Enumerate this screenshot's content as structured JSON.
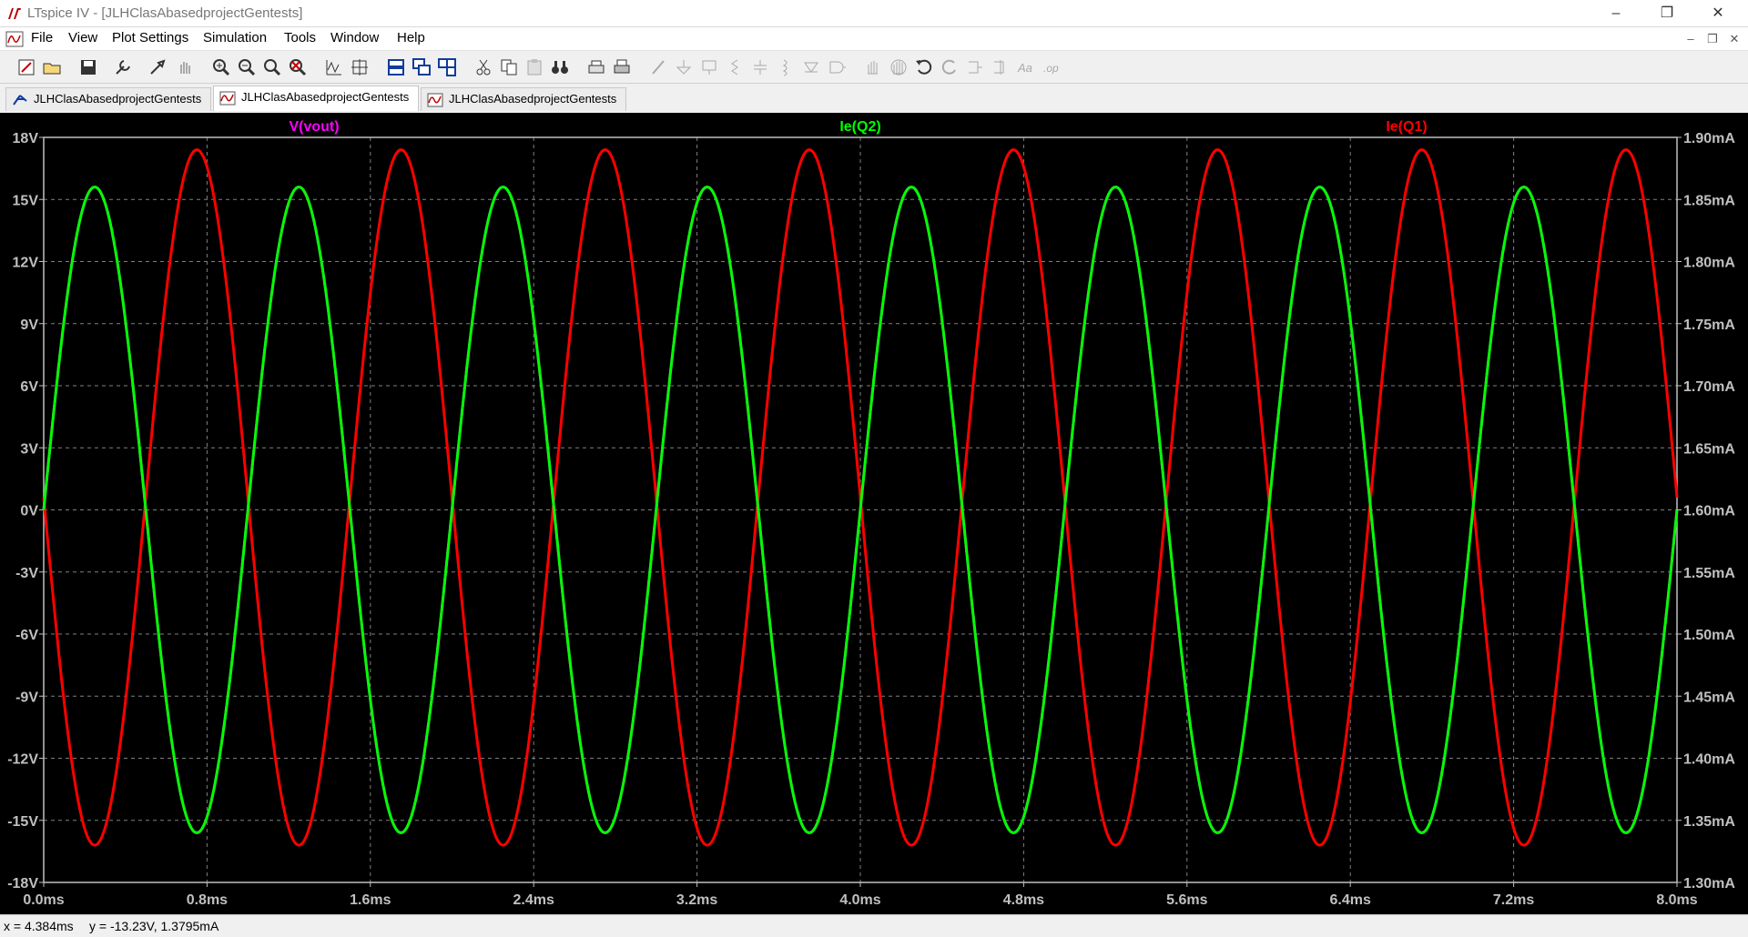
{
  "window": {
    "title": "LTspice IV - [JLHClasAbasedprojectGentests]",
    "controls": {
      "minimize": "–",
      "restore": "❐",
      "close": "✕"
    }
  },
  "menu": {
    "items": [
      "File",
      "View",
      "Plot Settings",
      "Simulation",
      "Tools",
      "Window",
      "Help"
    ],
    "mdi_controls": {
      "minimize": "–",
      "restore": "❐",
      "close": "✕"
    }
  },
  "toolbar": {
    "icons": [
      "new-schematic-icon",
      "open-icon",
      "save-icon",
      "control-panel-icon",
      "run-icon",
      "halt-icon",
      "zoom-in-icon",
      "zoom-out-icon",
      "zoom-full-icon",
      "zoom-cancel-icon",
      "autorange-icon",
      "cursor-icon",
      "tile-horizontal-icon",
      "cascade-icon",
      "tile-icon",
      "cut-icon",
      "copy-icon",
      "paste-icon",
      "find-icon",
      "print-preview-icon",
      "print-icon",
      "wire-icon",
      "ground-icon",
      "label-icon",
      "resistor-icon",
      "capacitor-icon",
      "inductor-icon",
      "diode-icon",
      "component-icon",
      "move-icon",
      "drag-icon",
      "undo-icon",
      "redo-icon",
      "rotate-icon",
      "mirror-icon",
      "text-icon",
      "spice-directive-icon"
    ]
  },
  "tabs": [
    {
      "label": "JLHClasAbasedprojectGentests",
      "icon": "schematic-icon",
      "active": false
    },
    {
      "label": "JLHClasAbasedprojectGentests",
      "icon": "waveform-icon",
      "active": true
    },
    {
      "label": "JLHClasAbasedprojectGentests",
      "icon": "waveform-icon",
      "active": false
    }
  ],
  "status": {
    "x_readout": "x = 4.384ms",
    "y_readout": "y = -13.23V, 1.3795mA"
  },
  "chart_data": {
    "type": "line",
    "background": "#000000",
    "grid": true,
    "xlim": [
      0,
      8
    ],
    "ylim_left": [
      -18,
      18
    ],
    "ylim_right": [
      1.3,
      1.9
    ],
    "x_tick_labels": [
      "0.0ms",
      "0.8ms",
      "1.6ms",
      "2.4ms",
      "3.2ms",
      "4.0ms",
      "4.8ms",
      "5.6ms",
      "6.4ms",
      "7.2ms",
      "8.0ms"
    ],
    "x_ticks": [
      0,
      0.8,
      1.6,
      2.4,
      3.2,
      4.0,
      4.8,
      5.6,
      6.4,
      7.2,
      8.0
    ],
    "y_left_tick_labels": [
      "18V",
      "15V",
      "12V",
      "9V",
      "6V",
      "3V",
      "0V",
      "-3V",
      "-6V",
      "-9V",
      "-12V",
      "-15V",
      "-18V"
    ],
    "y_left_ticks": [
      18,
      15,
      12,
      9,
      6,
      3,
      0,
      -3,
      -6,
      -9,
      -12,
      -15,
      -18
    ],
    "y_right_tick_labels": [
      "1.90mA",
      "1.85mA",
      "1.80mA",
      "1.75mA",
      "1.70mA",
      "1.65mA",
      "1.60mA",
      "1.55mA",
      "1.50mA",
      "1.45mA",
      "1.40mA",
      "1.35mA",
      "1.30mA"
    ],
    "y_right_ticks": [
      1.9,
      1.85,
      1.8,
      1.75,
      1.7,
      1.65,
      1.6,
      1.55,
      1.5,
      1.45,
      1.4,
      1.35,
      1.3
    ],
    "series": [
      {
        "name": "V(vout)",
        "color": "#ff00ff",
        "axis": "left",
        "unit": "V",
        "waveform": "sine",
        "frequency_khz": 1.0,
        "amplitude": 15.6,
        "offset": 0.0,
        "phase_deg": 0
      },
      {
        "name": "Ie(Q2)",
        "color": "#00ff00",
        "axis": "right",
        "unit": "mA",
        "waveform": "sine",
        "frequency_khz": 1.0,
        "amplitude": 0.26,
        "offset": 1.6,
        "phase_deg": 0
      },
      {
        "name": "Ie(Q1)",
        "color": "#ff0000",
        "axis": "right",
        "unit": "mA",
        "waveform": "sine",
        "frequency_khz": 1.0,
        "amplitude": 0.28,
        "offset": 1.61,
        "phase_deg": 180
      }
    ]
  }
}
